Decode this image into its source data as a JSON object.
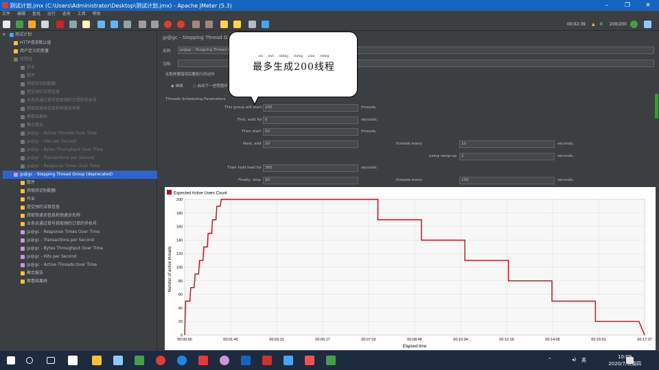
{
  "window": {
    "title": "测试计划.jmx (C:\\Users\\Administrator\\Desktop\\测试计划.jmx) - Apache JMeter (5.3)"
  },
  "menu": [
    "文件",
    "编辑",
    "查找",
    "运行",
    "选项",
    "工具",
    "帮助"
  ],
  "status": {
    "elapsed": "00:02:39",
    "warnings": "0",
    "threads": "200/200"
  },
  "tree": {
    "root": "测试计划",
    "items": [
      {
        "label": "HTTP请求默认值",
        "indent": 1
      },
      {
        "label": "用户定义的变量",
        "indent": 1
      },
      {
        "label": "线程组",
        "indent": 1,
        "disabled": true
      },
      {
        "label": "作业",
        "indent": 2,
        "disabled": true
      },
      {
        "label": "数件",
        "indent": 2,
        "disabled": true
      },
      {
        "label": "获取待识别配额",
        "indent": 2,
        "disabled": true
      },
      {
        "label": "提交预约详单信息",
        "indent": 2,
        "disabled": true
      },
      {
        "label": "业务员通过单号获取预约订单的手机号",
        "indent": 2,
        "disabled": true
      },
      {
        "label": "获取快递员信息和快递员名称",
        "indent": 2,
        "disabled": true
      },
      {
        "label": "察看结果树",
        "indent": 2,
        "disabled": true
      },
      {
        "label": "聚合报告",
        "indent": 2,
        "disabled": true
      },
      {
        "label": "jp@gc - Active Threads Over Time",
        "indent": 2,
        "disabled": true
      },
      {
        "label": "jp@gc - Hits per Second",
        "indent": 2,
        "disabled": true
      },
      {
        "label": "jp@gc - Bytes Throughput Over Time",
        "indent": 2,
        "disabled": true
      },
      {
        "label": "jp@gc - Transactions per Second",
        "indent": 2,
        "disabled": true
      },
      {
        "label": "jp@gc - Response Times Over Time",
        "indent": 2,
        "disabled": true
      },
      {
        "label": "jp@gc - Stepping Thread Group (deprecated)",
        "indent": 1,
        "selected": true
      },
      {
        "label": "数件",
        "indent": 2
      },
      {
        "label": "获取待识别配额",
        "indent": 2
      },
      {
        "label": "作业",
        "indent": 2
      },
      {
        "label": "提交预约详单信息",
        "indent": 2
      },
      {
        "label": "获取快递员信息和快递员名称",
        "indent": 2
      },
      {
        "label": "业务员通过单号获取预约订单的手机号",
        "indent": 2
      },
      {
        "label": "jp@gc - Response Times Over Time",
        "indent": 2
      },
      {
        "label": "jp@gc - Transactions per Second",
        "indent": 2
      },
      {
        "label": "jp@gc - Bytes Throughput Over Time",
        "indent": 2
      },
      {
        "label": "jp@gc - Hits per Second",
        "indent": 2
      },
      {
        "label": "jp@gc - Active Threads Over Time",
        "indent": 2
      },
      {
        "label": "聚合报告",
        "indent": 2
      },
      {
        "label": "察看结果树",
        "indent": 2
      }
    ]
  },
  "panel": {
    "header": "jp@gc - Stepping Thread G",
    "name_label": "名称:",
    "name_value": "jp@gc - Stepping Thread G",
    "comment_label": "注释:",
    "action_label": "在取样器错误后要执行的动作",
    "continue_label": "继续",
    "next_loop_label": "启动下一进程循环",
    "params_label": "Threads Scheduling Parameters",
    "rows": {
      "this_group": {
        "label": "This group will start",
        "value": "200",
        "unit": "threads;"
      },
      "first_wait": {
        "label": "First, wait for",
        "value": "0",
        "unit": "seconds;"
      },
      "then_start": {
        "label": "Then start",
        "value": "50",
        "unit": "threads;"
      },
      "next_add": {
        "label": "Next, add",
        "value": "20",
        "mid": "threads every",
        "value2": "10",
        "unit": "seconds,"
      },
      "ramp": {
        "label": "using ramp-up",
        "value": "2",
        "unit": "seconds."
      },
      "hold": {
        "label": "Then hold load for",
        "value": "360",
        "unit": "seconds."
      },
      "stop": {
        "label": "Finally, stop",
        "value": "30",
        "mid": "threads every",
        "value2": "100",
        "unit": "seconds."
      }
    }
  },
  "callout": {
    "text": "最多生成200线程",
    "ruby": "zuì duō shēng chéng xiàn chéng"
  },
  "chart_data": {
    "type": "line",
    "legend": "Expected Active Users Count",
    "ylabel": "Number of active threads",
    "xlabel": "Elapsed time",
    "ylim": [
      0,
      200
    ],
    "yticks": [
      0,
      20,
      40,
      60,
      80,
      100,
      120,
      140,
      160,
      180,
      200
    ],
    "xticks": [
      "00:00:00",
      "00:01:45",
      "00:03:31",
      "00:05:17",
      "00:07:02",
      "00:08:48",
      "00:10:34",
      "00:12:19",
      "00:14:05",
      "00:15:51",
      "00:17:37"
    ],
    "xmax_seconds": 1057,
    "color": "#e0000f",
    "points": [
      [
        0,
        0
      ],
      [
        2,
        50
      ],
      [
        12,
        50
      ],
      [
        14,
        70
      ],
      [
        22,
        70
      ],
      [
        24,
        90
      ],
      [
        32,
        90
      ],
      [
        34,
        110
      ],
      [
        42,
        110
      ],
      [
        44,
        130
      ],
      [
        52,
        130
      ],
      [
        54,
        150
      ],
      [
        62,
        150
      ],
      [
        64,
        170
      ],
      [
        72,
        170
      ],
      [
        74,
        190
      ],
      [
        82,
        190
      ],
      [
        84,
        200
      ],
      [
        444,
        200
      ],
      [
        444,
        170
      ],
      [
        544,
        170
      ],
      [
        544,
        140
      ],
      [
        644,
        140
      ],
      [
        644,
        110
      ],
      [
        744,
        110
      ],
      [
        744,
        80
      ],
      [
        844,
        80
      ],
      [
        844,
        50
      ],
      [
        944,
        50
      ],
      [
        944,
        20
      ],
      [
        1044,
        20
      ],
      [
        1057,
        0
      ]
    ]
  },
  "clock": {
    "time": "10:09",
    "date": "2020/7/9/周四"
  },
  "tray": {
    "lang": "英"
  }
}
